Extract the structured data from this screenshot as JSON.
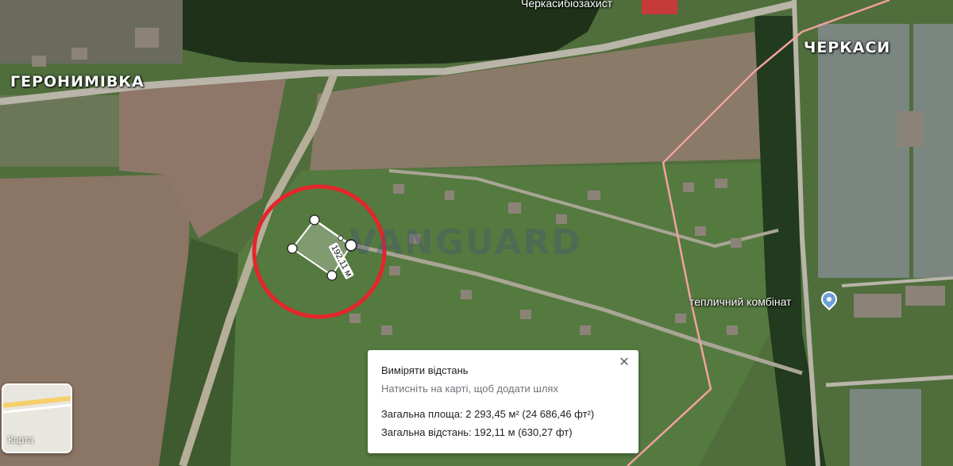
{
  "map": {
    "labels": {
      "town_west": "ГЕРОНИМІВКА",
      "town_east": "ЧЕРКАСИ",
      "poi_top": "Черкасибіозахист",
      "poi_greenhouse": "тепличний комбінат"
    },
    "watermark": "VANGUARD",
    "measure_label": "192,11 м",
    "layer_switch_label": "Карта",
    "colors": {
      "highlight_circle": "#e3262b",
      "boundary": "#f2a0a0",
      "poi_pin": "#6b9fd8"
    }
  },
  "measure_panel": {
    "title": "Виміряти відстань",
    "hint": "Натисніть на карті, щоб додати шлях",
    "area": "Загальна площа: 2 293,45 м² (24 686,46 фт²)",
    "distance": "Загальна відстань: 192,11 м (630,27 фт)",
    "close_icon": "close-icon"
  }
}
